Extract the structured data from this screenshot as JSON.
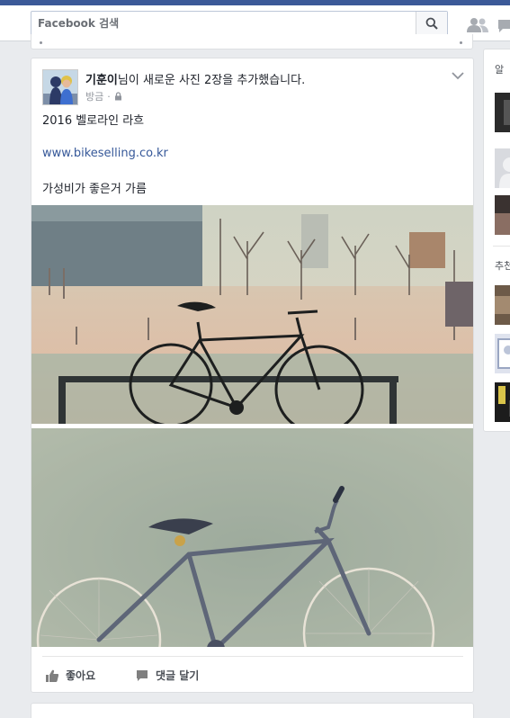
{
  "search": {
    "placeholder": "Facebook 검색"
  },
  "post": {
    "author": "기훈이",
    "action_text": "님이 새로운 사진 2장을 추가했습니다.",
    "timestamp": "방금",
    "separator": "·",
    "line1": "2016 벨로라인 라흐",
    "link": "www.bikeselling.co.kr",
    "line2": "가성비가 좋은거 가름",
    "like_label": "좋아요",
    "comment_label": "댓글 달기"
  },
  "right_column": {
    "section1_label": "알",
    "section2_label": "추천"
  },
  "colors": {
    "brand": "#3b5998",
    "link": "#365899"
  }
}
